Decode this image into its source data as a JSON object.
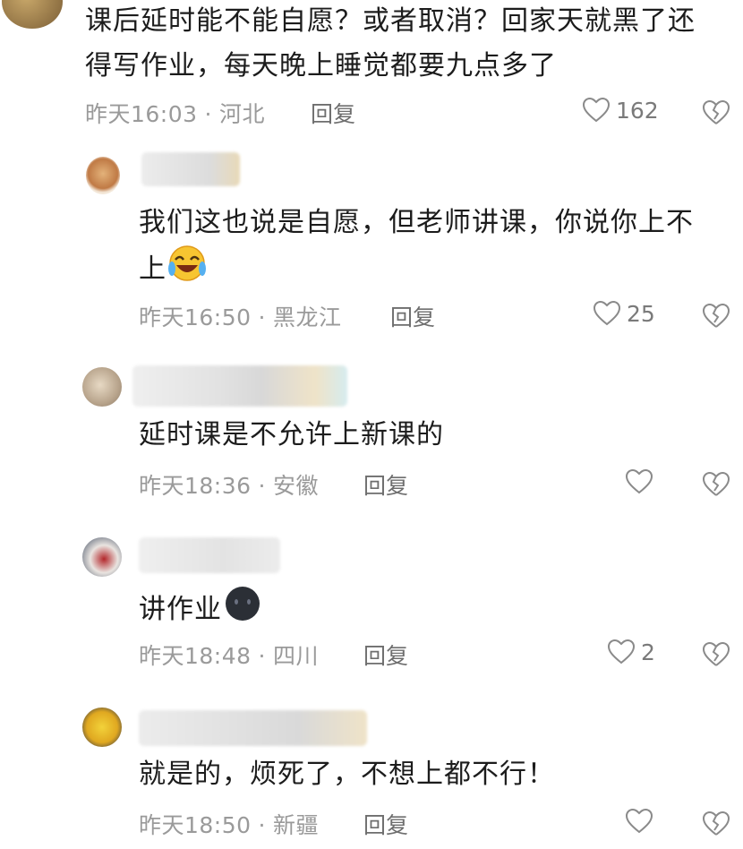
{
  "comments": [
    {
      "text_lines": [
        "课后延时能不能自愿？或者取消？回家天就黑了还",
        "得写作业，每天晚上睡觉都要九点多了"
      ],
      "time": "昨天16:03",
      "location": "河北",
      "reply_label": "回复",
      "likes": "162"
    },
    {
      "text_lines": [
        "我们这也说是自愿，但老师讲课，你说你上不",
        "上"
      ],
      "emoji": "laughing-crying-emoji",
      "time": "昨天16:50",
      "location": "黑龙江",
      "reply_label": "回复",
      "likes": "25"
    },
    {
      "text_lines": [
        "延时课是不允许上新课的"
      ],
      "time": "昨天18:36",
      "location": "安徽",
      "reply_label": "回复",
      "likes": ""
    },
    {
      "text_lines": [
        "讲作业"
      ],
      "emoji": "dark-face-emoji",
      "time": "昨天18:48",
      "location": "四川",
      "reply_label": "回复",
      "likes": "2"
    },
    {
      "text_lines": [
        "就是的，烦死了，不想上都不行！"
      ],
      "time": "昨天18:50",
      "location": "新疆",
      "reply_label": "回复",
      "likes": ""
    }
  ],
  "colors": {
    "meta": "#9a9a9a",
    "text": "#1c1c1c",
    "icon": "#8a8a8a"
  },
  "icons": {
    "like": "heart-outline-icon",
    "dislike": "broken-heart-icon"
  }
}
